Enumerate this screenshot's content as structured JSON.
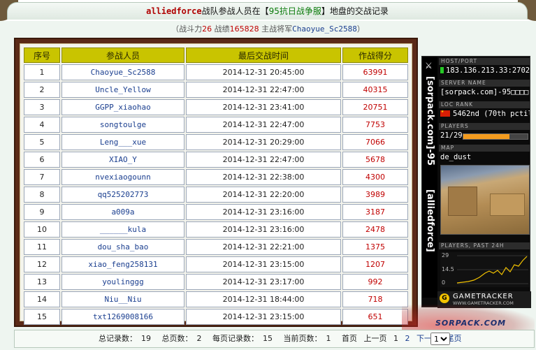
{
  "header": {
    "team_name": "alliedforce",
    "text_before_server": "战队参战人员在【",
    "server_name": "95抗日战争服",
    "text_after_server": "】地盘的交战记录"
  },
  "stats": {
    "prefix": "（战斗力",
    "power": "26",
    "score_label": " 战绩",
    "score": "165828",
    "commander_label": " 主战将军",
    "commander": "Chaoyue_Sc2588",
    "suffix": "）"
  },
  "table": {
    "headers": [
      "序号",
      "参战人员",
      "最后交战时间",
      "作战得分"
    ],
    "rows": [
      {
        "no": "1",
        "name": "Chaoyue_Sc2588",
        "time": "2014-12-31 20:45:00",
        "score": "63991"
      },
      {
        "no": "2",
        "name": "Uncle_Yellow",
        "time": "2014-12-31 22:47:00",
        "score": "40315"
      },
      {
        "no": "3",
        "name": "GGPP_xiaohao",
        "time": "2014-12-31 23:41:00",
        "score": "20751"
      },
      {
        "no": "4",
        "name": "songtoulge",
        "time": "2014-12-31 22:47:00",
        "score": "7753"
      },
      {
        "no": "5",
        "name": "Leng___xue",
        "time": "2014-12-31 20:29:00",
        "score": "7066"
      },
      {
        "no": "6",
        "name": "XIAO_Y",
        "time": "2014-12-31 22:47:00",
        "score": "5678"
      },
      {
        "no": "7",
        "name": "nvexiaogounn",
        "time": "2014-12-31 22:38:00",
        "score": "4300"
      },
      {
        "no": "8",
        "name": "qq525202773",
        "time": "2014-12-31 22:20:00",
        "score": "3989"
      },
      {
        "no": "9",
        "name": "a009a",
        "time": "2014-12-31 23:16:00",
        "score": "3187"
      },
      {
        "no": "10",
        "name": "______kula",
        "time": "2014-12-31 23:16:00",
        "score": "2478"
      },
      {
        "no": "11",
        "name": "dou_sha_bao",
        "time": "2014-12-31 22:21:00",
        "score": "1375"
      },
      {
        "no": "12",
        "name": "xiao_feng258131",
        "time": "2014-12-31 23:15:00",
        "score": "1207"
      },
      {
        "no": "13",
        "name": "youlinggg",
        "time": "2014-12-31 23:17:00",
        "score": "992"
      },
      {
        "no": "14",
        "name": "Niu__Niu",
        "time": "2014-12-31 18:44:00",
        "score": "718"
      },
      {
        "no": "15",
        "name": "txt1269008166",
        "time": "2014-12-31 23:15:00",
        "score": "651"
      }
    ]
  },
  "tracker": {
    "side_text_top": "[sorpack.com]-95",
    "side_text_bottom": "[alliedforce]",
    "host_label": "HOST/PORT",
    "host": "183.136.213.33:27025",
    "server_label": "SERVER NAME",
    "server": "[sorpack.com]-95□□□□",
    "rank_label": "LOC RANK",
    "rank": "5462nd (70th pctile)",
    "players_label": "PLAYERS",
    "players": "21/29",
    "players_fill": 0.72,
    "map_label": "MAP",
    "map": "de_dust",
    "graph_label": "PLAYERS, PAST 24H",
    "graph_ticks": [
      "29",
      "14.5",
      "0"
    ],
    "brand": "GAMETRACKER",
    "brand_url": "WWW.GAMETRACKER.COM",
    "colors": {
      "bar": "#f29b1e",
      "graph_line": "#f2c200"
    }
  },
  "watermark": {
    "text": "SORPACK.COM"
  },
  "pager": {
    "total_records_label": "总记录数：",
    "total_records": "19",
    "total_pages_label": "总页数：",
    "total_pages": "2",
    "per_page_label": "每页记录数：",
    "per_page": "15",
    "current_page_label": "当前页数：",
    "current_page": "1",
    "first": "首页",
    "prev": "上一页",
    "page1": "1",
    "page2": "2",
    "next": "下一页",
    "last": "尾页",
    "select_value": "1"
  }
}
